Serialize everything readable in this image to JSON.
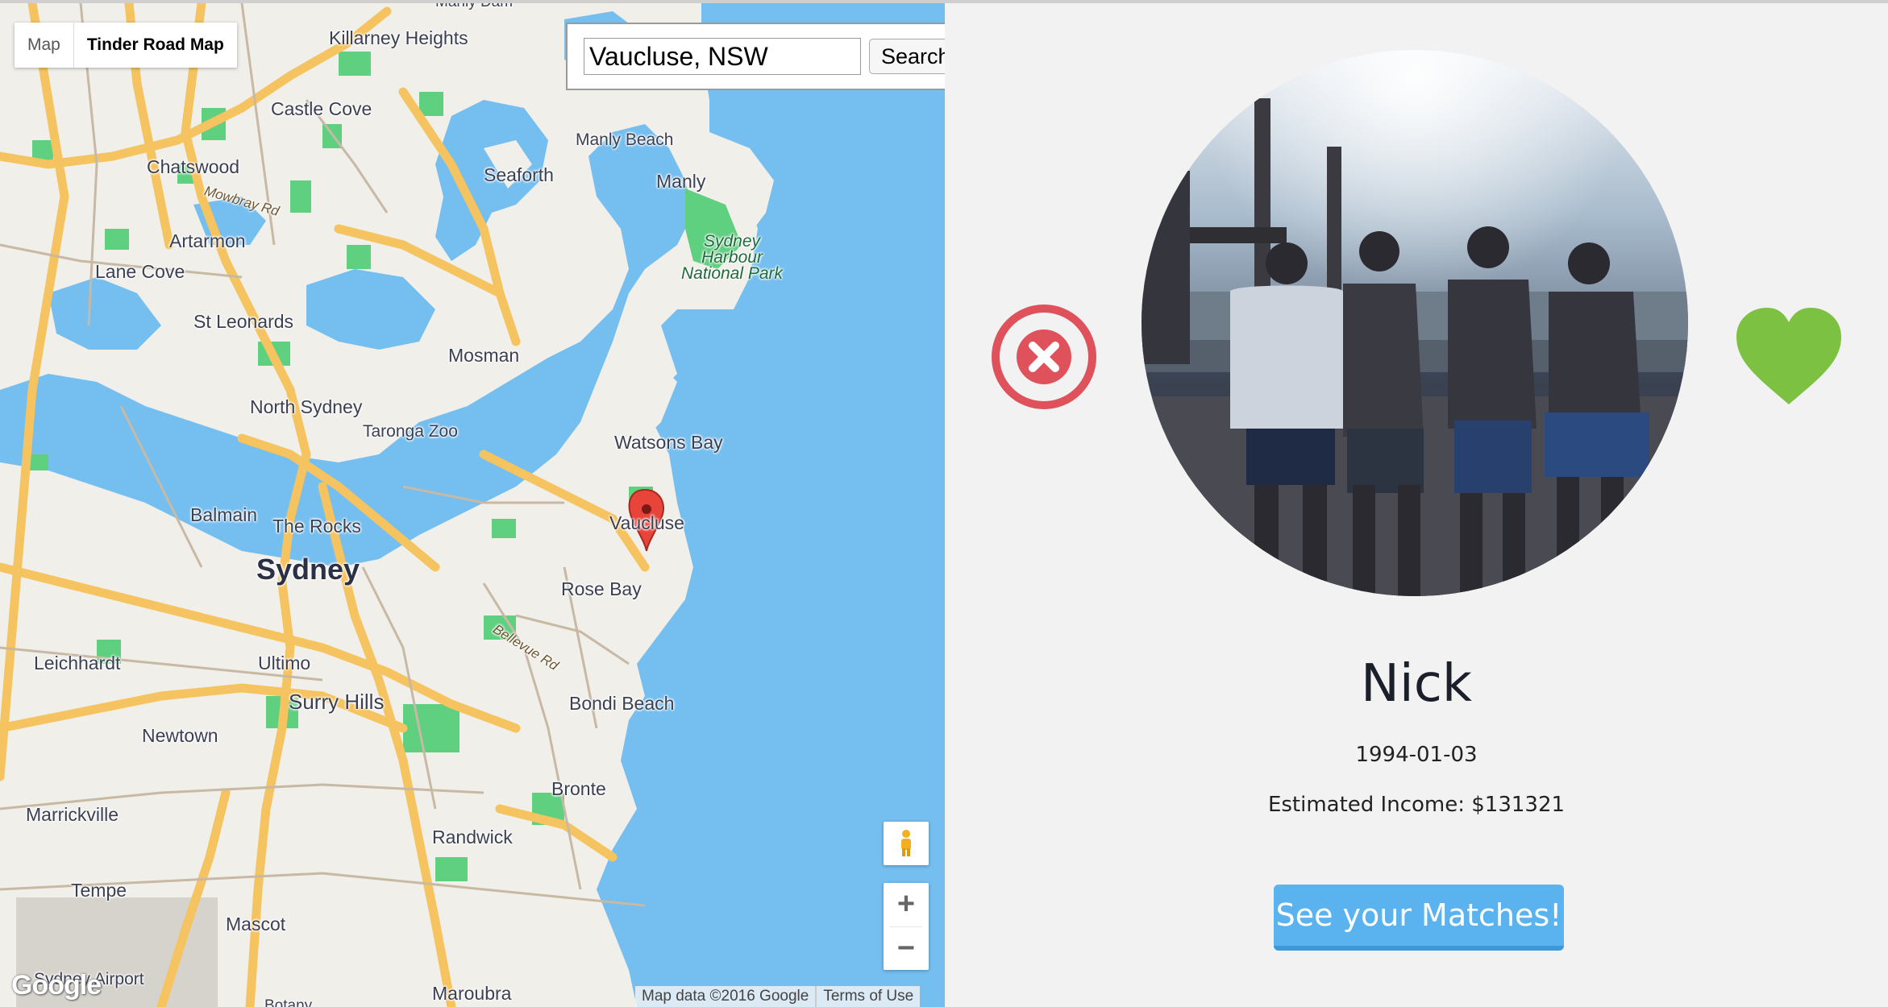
{
  "map": {
    "type_control": {
      "options": [
        "Map",
        "Tinder Road Map"
      ],
      "selected": "Tinder Road Map"
    },
    "search": {
      "value": "Vaucluse, NSW",
      "button_label": "Search"
    },
    "labels": {
      "killarney_heights": "Killarney Heights",
      "castle_cove": "Castle Cove",
      "chatswood": "Chatswood",
      "mowbray_rd": "Mowbray Rd",
      "artarmon": "Artarmon",
      "lane_cove": "Lane Cove",
      "st_leonards": "St Leonards",
      "north_sydney": "North Sydney",
      "taronga_zoo": "Taronga Zoo",
      "mosman": "Mosman",
      "seaforth": "Seaforth",
      "manly_beach": "Manly Beach",
      "manly": "Manly",
      "sydney_harbour_np": "Sydney Harbour National Park",
      "watsons_bay": "Watsons Bay",
      "vaucluse": "Vaucluse",
      "balmain": "Balmain",
      "the_rocks": "The Rocks",
      "sydney": "Sydney",
      "rose_bay": "Rose Bay",
      "bellevue_rd": "Bellevue Rd",
      "leichhardt": "Leichhardt",
      "ultimo": "Ultimo",
      "surry_hills": "Surry Hills",
      "bondi_beach": "Bondi Beach",
      "newtown": "Newtown",
      "marrickville": "Marrickville",
      "bronte": "Bronte",
      "randwick": "Randwick",
      "tempe": "Tempe",
      "mascot": "Mascot",
      "sydney_airport": "Sydney Airport",
      "botany": "Botany",
      "maroubra": "Maroubra",
      "manly_dam": "Manly Dam"
    },
    "zoom_in": "+",
    "zoom_out": "−",
    "attribution": "Map data ©2016 Google",
    "terms": "Terms of Use",
    "logo": "Google",
    "colors": {
      "water": "#74bef0",
      "land": "#f1efea",
      "park": "#5fcf80",
      "road": "#f5c35f",
      "marker": "#e8443a"
    }
  },
  "profile": {
    "name": "Nick",
    "dob": "1994-01-03",
    "income": "Estimated Income: $131321",
    "matches_button": "See your Matches!",
    "colors": {
      "reject": "#e0525b",
      "like": "#7dc142",
      "button": "#5ab3ee"
    }
  }
}
